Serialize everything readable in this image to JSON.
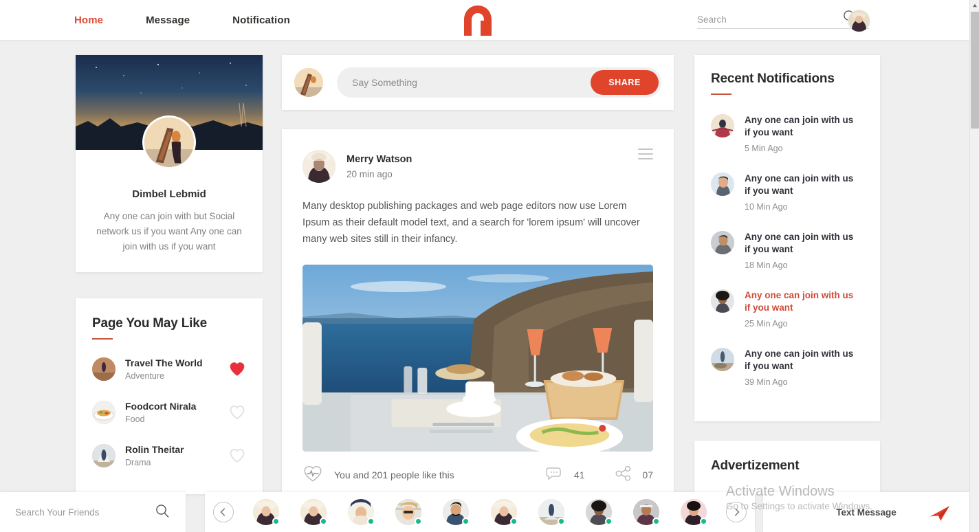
{
  "header": {
    "nav": [
      {
        "label": "Home",
        "active": true
      },
      {
        "label": "Message",
        "active": false
      },
      {
        "label": "Notification",
        "active": false
      }
    ],
    "logo_name": "logo-a-icon",
    "search": {
      "placeholder": "Search",
      "value": ""
    }
  },
  "profile": {
    "name": "Dimbel Lebmid",
    "bio": "Any one can join with but Social network us if you want Any one can join with us if you want"
  },
  "pages_you_may_like": {
    "title": "Page You May Like",
    "items": [
      {
        "name": "Travel The World",
        "category": "Adventure",
        "liked": true
      },
      {
        "name": "Foodcort Nirala",
        "category": "Food",
        "liked": false
      },
      {
        "name": "Rolin Theitar",
        "category": "Drama",
        "liked": false
      }
    ]
  },
  "composer": {
    "placeholder": "Say Something",
    "value": "",
    "share_label": "SHARE"
  },
  "post": {
    "author": "Merry Watson",
    "time": "20 min ago",
    "text": "Many desktop publishing packages and web page editors now use Lorem Ipsum as their default model text, and a search for 'lorem ipsum' will uncover many web sites still in their infancy.",
    "likes_text": "You and 201 people like this",
    "comments_count": "41",
    "shares_count": "07"
  },
  "notifications": {
    "title": "Recent Notifications",
    "items": [
      {
        "text": "Any one can join with us if you want",
        "time": "5 Min Ago",
        "unread": false
      },
      {
        "text": "Any one can join with us if you want",
        "time": "10 Min Ago",
        "unread": false
      },
      {
        "text": "Any one can join with us if you want",
        "time": "18 Min Ago",
        "unread": false
      },
      {
        "text": "Any one can join with us if you want",
        "time": "25 Min Ago",
        "unread": true
      },
      {
        "text": "Any one can join with us if you want",
        "time": "39 Min Ago",
        "unread": false
      }
    ]
  },
  "advertisement": {
    "title": "Advertizement"
  },
  "bottom_bar": {
    "friend_search_placeholder": "Search Your Friends",
    "friend_search_value": "",
    "message_label": "Text Message",
    "friends_online_count": 10
  },
  "watermark": {
    "title": "Activate Windows",
    "subtitle": "Go to Settings to activate Windows."
  },
  "colors": {
    "accent": "#e0442b",
    "accent_text": "#e04a35",
    "unread": "#d14a37",
    "page_bg": "#efefef",
    "card_bg": "#ffffff",
    "online": "#18b98a"
  }
}
